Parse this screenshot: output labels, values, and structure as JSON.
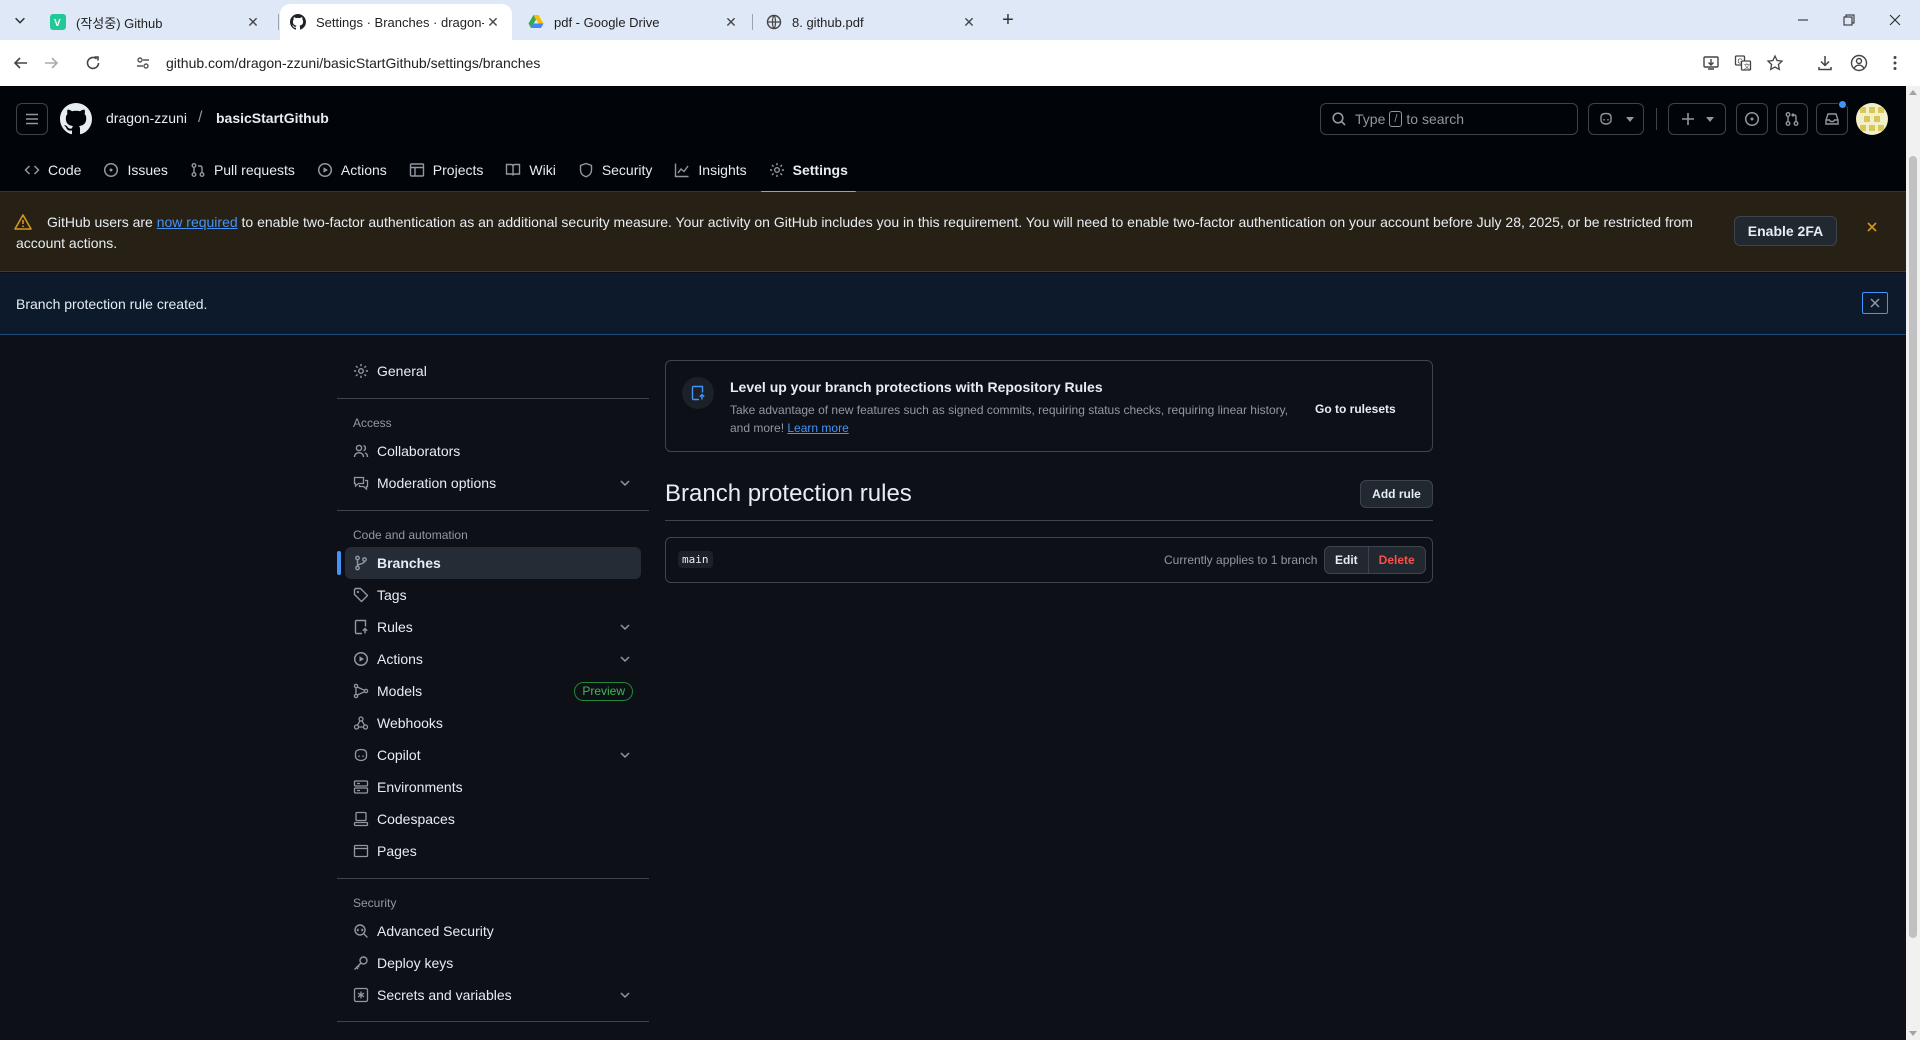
{
  "browser": {
    "tabs": [
      {
        "title": "(작성중) Github",
        "favicon": "velog-icon",
        "active": false
      },
      {
        "title": "Settings · Branches · dragon-zz",
        "favicon": "github-icon",
        "active": true
      },
      {
        "title": "pdf - Google Drive",
        "favicon": "google-drive-icon",
        "active": false
      },
      {
        "title": "8. github.pdf",
        "favicon": "globe-icon",
        "active": false
      }
    ],
    "url": "github.com/dragon-zzuni/basicStartGithub/settings/branches"
  },
  "header": {
    "owner": "dragon-zzuni",
    "separator": "/",
    "repo": "basicStartGithub",
    "search_prefix": "Type",
    "search_key": "/",
    "search_suffix": "to search"
  },
  "repo_nav": [
    {
      "label": "Code",
      "icon": "code-icon"
    },
    {
      "label": "Issues",
      "icon": "issue-icon"
    },
    {
      "label": "Pull requests",
      "icon": "pull-request-icon"
    },
    {
      "label": "Actions",
      "icon": "play-icon"
    },
    {
      "label": "Projects",
      "icon": "table-icon"
    },
    {
      "label": "Wiki",
      "icon": "book-icon"
    },
    {
      "label": "Security",
      "icon": "shield-icon"
    },
    {
      "label": "Insights",
      "icon": "graph-icon"
    },
    {
      "label": "Settings",
      "icon": "gear-icon",
      "active": true
    }
  ],
  "banner_2fa": {
    "text_before": "GitHub users are ",
    "link": "now required",
    "text_after": " to enable two-factor authentication as an additional security measure. Your activity on GitHub includes you in this requirement. You will need to enable two-factor authentication on your account before July 28, 2025, or be restricted from account actions.",
    "button": "Enable 2FA"
  },
  "banner_info": {
    "text": "Branch protection rule created."
  },
  "sidebar": {
    "general": "General",
    "access_heading": "Access",
    "access": [
      {
        "label": "Collaborators",
        "icon": "people-icon"
      },
      {
        "label": "Moderation options",
        "icon": "comment-discussion-icon",
        "expandable": true
      }
    ],
    "code_heading": "Code and automation",
    "code": [
      {
        "label": "Branches",
        "icon": "git-branch-icon",
        "active": true
      },
      {
        "label": "Tags",
        "icon": "tag-icon"
      },
      {
        "label": "Rules",
        "icon": "repo-push-icon",
        "expandable": true
      },
      {
        "label": "Actions",
        "icon": "play-icon",
        "expandable": true
      },
      {
        "label": "Models",
        "icon": "ai-model-icon",
        "badge": "Preview"
      },
      {
        "label": "Webhooks",
        "icon": "webhook-icon"
      },
      {
        "label": "Copilot",
        "icon": "copilot-icon",
        "expandable": true
      },
      {
        "label": "Environments",
        "icon": "server-icon"
      },
      {
        "label": "Codespaces",
        "icon": "codespaces-icon"
      },
      {
        "label": "Pages",
        "icon": "browser-icon"
      }
    ],
    "security_heading": "Security",
    "security": [
      {
        "label": "Advanced Security",
        "icon": "codescan-icon"
      },
      {
        "label": "Deploy keys",
        "icon": "key-icon"
      },
      {
        "label": "Secrets and variables",
        "icon": "key-asterisk-icon",
        "expandable": true
      }
    ]
  },
  "main": {
    "promo_title": "Level up your branch protections with Repository Rules",
    "promo_desc": "Take advantage of new features such as signed commits, requiring status checks, requiring linear history, and more! ",
    "promo_link": "Learn more",
    "promo_cta": "Go to rulesets",
    "title": "Branch protection rules",
    "add_rule": "Add rule",
    "rules": [
      {
        "name": "main",
        "applies": "Currently applies to 1 branch",
        "edit": "Edit",
        "delete": "Delete"
      }
    ]
  },
  "colors": {
    "accent": "#4493f8",
    "danger": "#f85149",
    "warning": "#d29922",
    "success": "#3fb950",
    "tab_underline": "#f78166"
  }
}
